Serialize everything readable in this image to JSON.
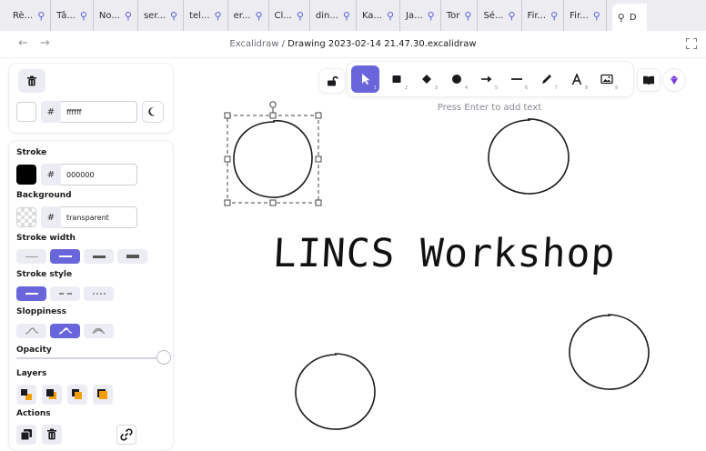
{
  "browser": {
    "tabs": [
      {
        "label": "Rè..."
      },
      {
        "label": "Tâ..."
      },
      {
        "label": "No..."
      },
      {
        "label": "ser..."
      },
      {
        "label": "tel..."
      },
      {
        "label": "er..."
      },
      {
        "label": "Cl..."
      },
      {
        "label": "din..."
      },
      {
        "label": "Ka..."
      },
      {
        "label": "Ja..."
      },
      {
        "label": "Tor"
      },
      {
        "label": "Sé..."
      },
      {
        "label": "Fir..."
      },
      {
        "label": "Fir..."
      }
    ],
    "active_tab_label": "D"
  },
  "titlebar": {
    "app": "Excalidraw",
    "separator": " / ",
    "filename": "Drawing 2023-02-14 21.47.30.excalidraw"
  },
  "panel": {
    "canvas_bg_hex": "ffffff",
    "stroke_label": "Stroke",
    "stroke_hex": "000000",
    "background_label": "Background",
    "background_hex": "transparent",
    "stroke_width_label": "Stroke width",
    "stroke_style_label": "Stroke style",
    "sloppiness_label": "Sloppiness",
    "opacity_label": "Opacity",
    "opacity_value": 100,
    "layers_label": "Layers",
    "actions_label": "Actions"
  },
  "toolbar": {
    "keys": [
      "1",
      "2",
      "3",
      "4",
      "5",
      "6",
      "7",
      "8",
      "9"
    ]
  },
  "canvas": {
    "hint": "Press Enter to add text",
    "text": "LINCS Workshop"
  },
  "colors": {
    "accent": "#6965db",
    "stroke": "#000000",
    "canvas_bg": "#ffffff"
  }
}
